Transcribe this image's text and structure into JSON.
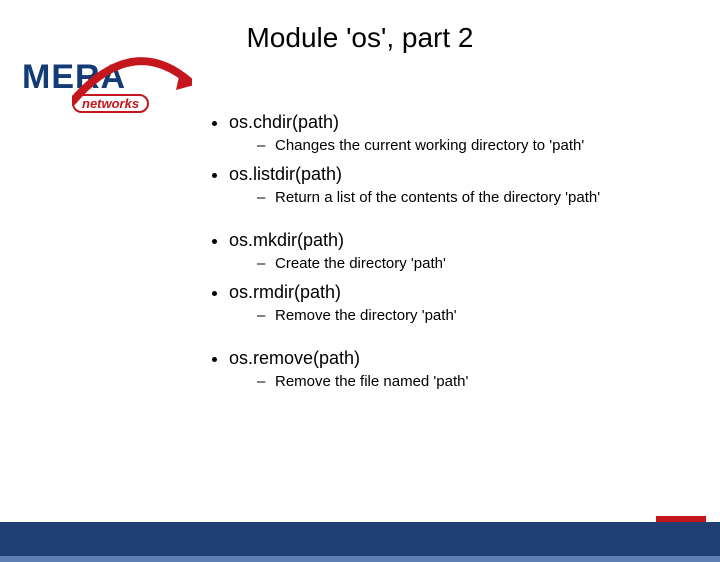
{
  "logo": {
    "text": "MERA",
    "subtext": "networks"
  },
  "title": "Module 'os', part 2",
  "items": [
    {
      "fn": "os.chdir(path)",
      "desc": "Changes the current working directory to 'path'"
    },
    {
      "fn": "os.listdir(path)",
      "desc": "Return a list of the contents of the directory 'path'"
    },
    {
      "fn": "os.mkdir(path)",
      "desc": "Create the directory 'path'"
    },
    {
      "fn": "os.rmdir(path)",
      "desc": "Remove the directory 'path'"
    },
    {
      "fn": "os.remove(path)",
      "desc": "Remove the file named 'path'"
    }
  ]
}
